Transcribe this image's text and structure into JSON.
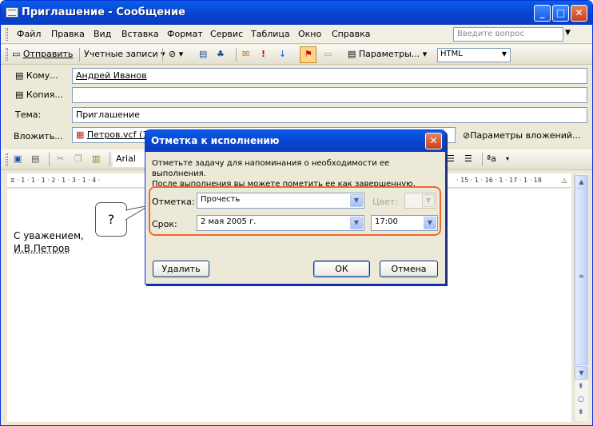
{
  "window": {
    "title": "Приглашение - Сообщение",
    "buttons": {
      "min": "_",
      "max": "□",
      "close": "✕"
    }
  },
  "menu": {
    "items": [
      "Файл",
      "Правка",
      "Вид",
      "Вставка",
      "Формат",
      "Сервис",
      "Таблица",
      "Окно",
      "Справка"
    ],
    "ask_placeholder": "Введите вопрос"
  },
  "toolbar1": {
    "send": "Отправить",
    "accounts": "Учетные записи",
    "options": "Параметры...",
    "format": "HTML"
  },
  "header_fields": {
    "to_label": "Кому...",
    "to_value": "Андрей Иванов",
    "cc_label": "Копия...",
    "cc_value": "",
    "subject_label": "Тема:",
    "subject_value": "Приглашение",
    "attach_label": "Вложить...",
    "attach_value": "Петров.vcf (1",
    "attach_options": "Параметры вложений..."
  },
  "toolbar2": {
    "font": "Arial"
  },
  "ruler": {
    "left": "· 1 · 1 · 1 · 2 · 1 · 3 · 1 · 4 ·",
    "right": "· 15 · 1 · 16 · 1 · 17 · 1 · 18"
  },
  "body": {
    "line1": "С уважением,",
    "line2": "И.В.Петров"
  },
  "dialog": {
    "title": "Отметка к исполнению",
    "description_line1": "Отметьте задачу для напоминания о необходимости ее выполнения.",
    "description_line2": "После выполнения вы можете пометить ее как завершенную.",
    "flag_label": "Отметка:",
    "flag_value": "Прочесть",
    "color_label": "Цвет:",
    "due_label": "Срок:",
    "due_date": "2 мая 2005 г.",
    "due_time": "17:00",
    "delete_button": "Удалить",
    "ok_button": "ОК",
    "cancel_button": "Отмена"
  },
  "callout": {
    "text": "?"
  },
  "colors": {
    "title_blue": "#0845d1",
    "highlight": "#f06a33",
    "window_bg": "#ece9d8"
  }
}
